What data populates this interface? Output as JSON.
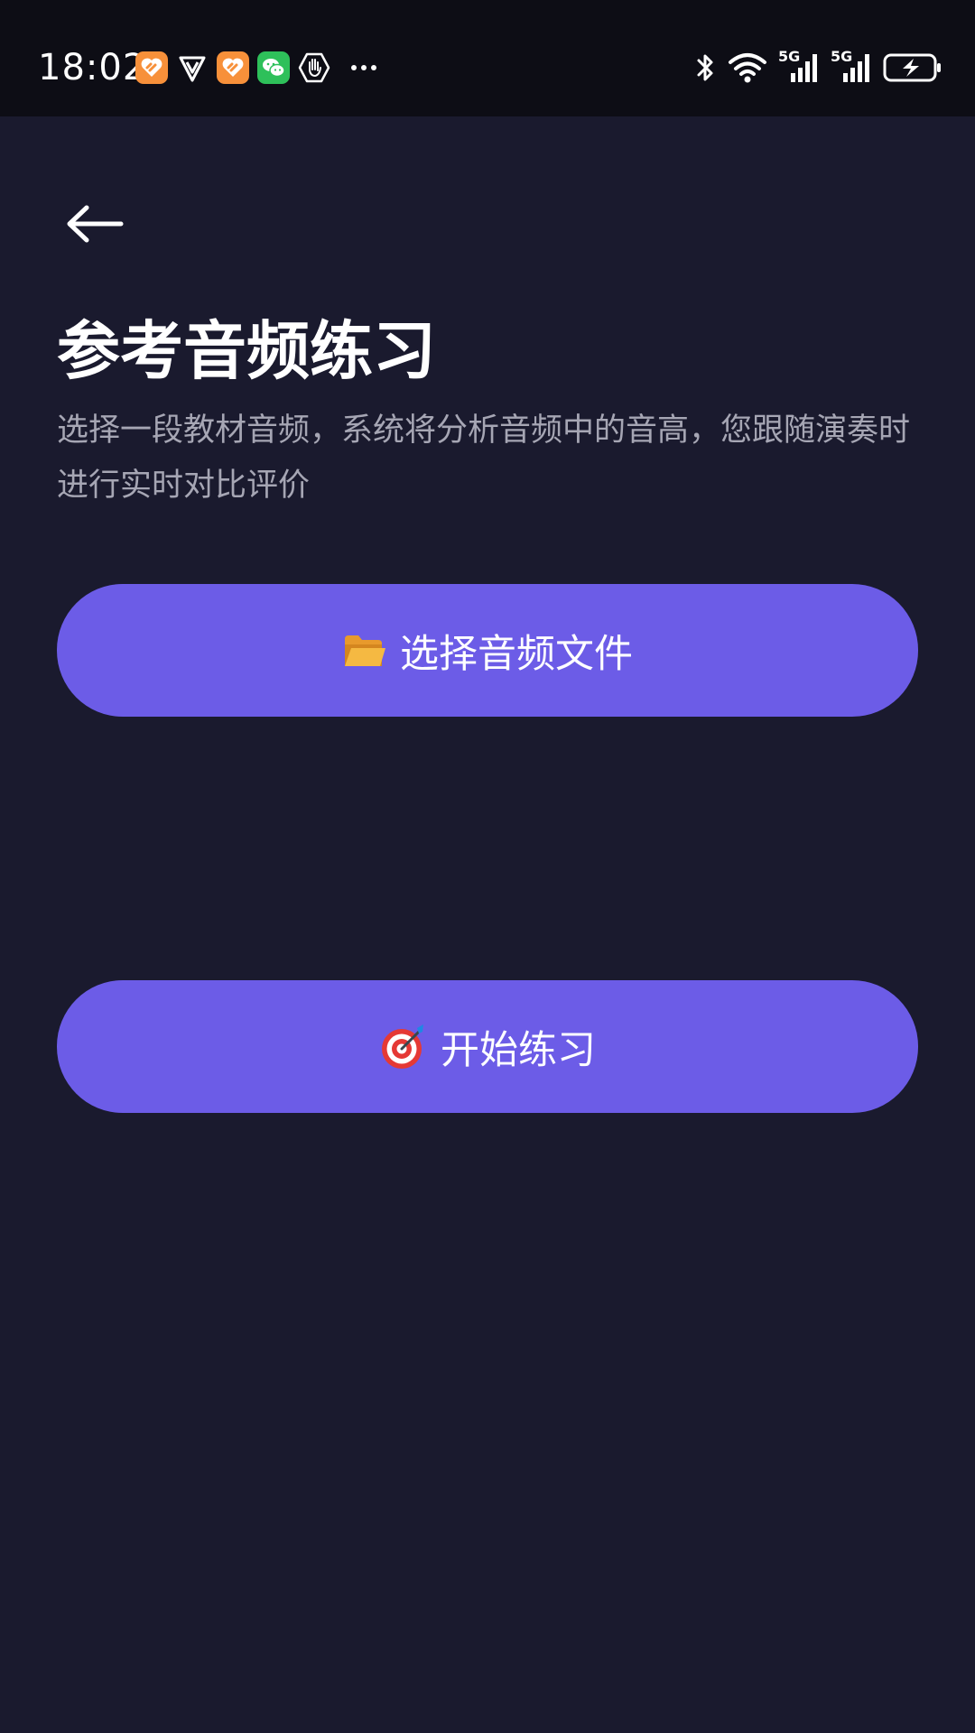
{
  "status_bar": {
    "time": "18:02",
    "notification_icons": [
      "huawei-health-icon",
      "shield-v-icon",
      "huawei-health-icon",
      "wechat-icon",
      "hand-icon"
    ],
    "system_icons": [
      "bluetooth-icon",
      "wifi-icon",
      "signal-5g-icon",
      "signal-5g-icon",
      "battery-charging-icon"
    ],
    "network_label_1": "5G",
    "network_label_2": "5G"
  },
  "header": {
    "back_icon": "arrow-left-icon",
    "title": "参考音频练习",
    "subtitle": "选择一段教材音频，系统将分析音频中的音高，您跟随演奏时进行实时对比评价"
  },
  "actions": {
    "select_file": {
      "icon": "open-folder-icon",
      "label": "选择音频文件"
    },
    "start_practice": {
      "icon": "target-icon",
      "label": "开始练习"
    }
  },
  "colors": {
    "background": "#1a1a2e",
    "status_bar": "#0d0d15",
    "accent": "#6c5ce7",
    "subtitle_text": "#a6a6b4"
  }
}
